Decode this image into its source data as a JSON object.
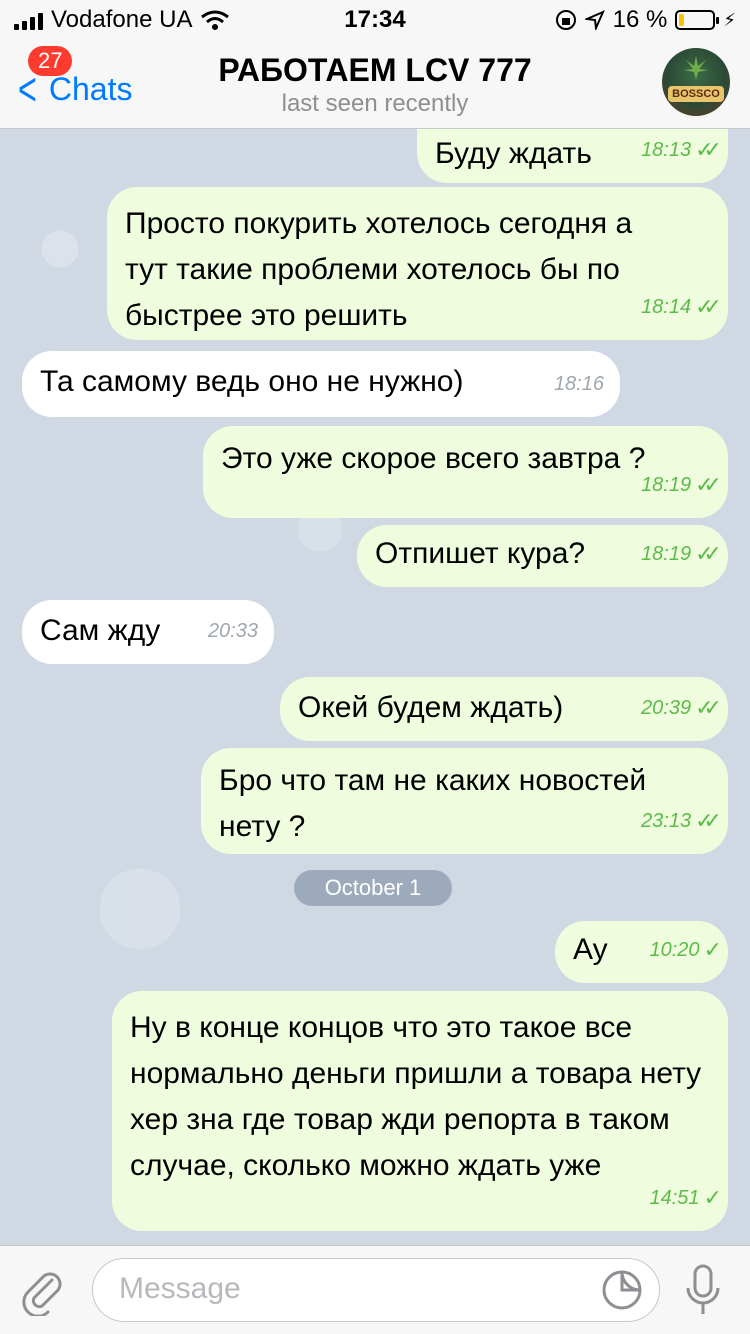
{
  "status_bar": {
    "carrier": "Vodafone UA",
    "time": "17:34",
    "battery_text": "16 %",
    "battery_level": 0.16
  },
  "nav": {
    "back_label": "Chats",
    "unread_badge": "27",
    "title": "РАБОТАЕМ LCV 777",
    "subtitle": "last seen recently",
    "avatar_text": "BOSSCO"
  },
  "messages": [
    {
      "dir": "out",
      "text": "Буду ждать",
      "time": "18:13",
      "status": "read"
    },
    {
      "dir": "out",
      "text": "Просто покурить хотелось сегодня а тут такие проблеми хотелось бы по быстрее это решить",
      "time": "18:14",
      "status": "read"
    },
    {
      "dir": "in",
      "text": "Та самому ведь оно не нужно)",
      "time": "18:16"
    },
    {
      "dir": "out",
      "text": "Это уже скорое всего завтра ?",
      "time": "18:19",
      "status": "read"
    },
    {
      "dir": "out",
      "text": "Отпишет кура?",
      "time": "18:19",
      "status": "read"
    },
    {
      "dir": "in",
      "text": "Сам жду",
      "time": "20:33"
    },
    {
      "dir": "out",
      "text": "Окей будем ждать)",
      "time": "20:39",
      "status": "read"
    },
    {
      "dir": "out",
      "text": "Бро что там не каких новостей нету ?",
      "time": "23:13",
      "status": "read"
    },
    {
      "dir": "out",
      "text": "Ау",
      "time": "10:20",
      "status": "sent"
    },
    {
      "dir": "out",
      "text": "Ну в конце концов что это такое все нормально деньги пришли а товара нету хер зна где товар жди репорта в таком случае, сколько можно ждать уже",
      "time": "14:51",
      "status": "sent"
    }
  ],
  "date_separator": "October 1",
  "input": {
    "placeholder": "Message"
  }
}
